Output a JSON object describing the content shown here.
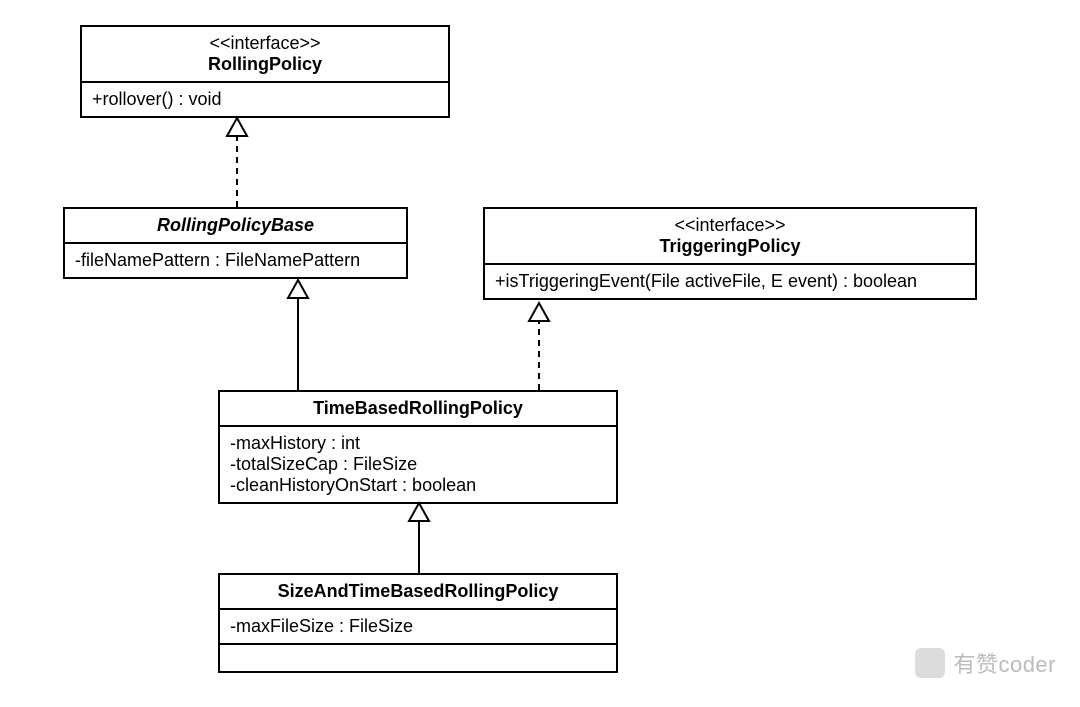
{
  "nodes": {
    "rollingPolicy": {
      "stereotype": "<<interface>>",
      "name": "RollingPolicy",
      "members": [
        "+rollover() : void"
      ]
    },
    "rollingPolicyBase": {
      "name": "RollingPolicyBase",
      "members": [
        "-fileNamePattern : FileNamePattern"
      ]
    },
    "triggeringPolicy": {
      "stereotype": "<<interface>>",
      "name": "TriggeringPolicy",
      "members": [
        "+isTriggeringEvent(File activeFile, E event) : boolean"
      ]
    },
    "timeBasedRollingPolicy": {
      "name": "TimeBasedRollingPolicy",
      "members": [
        "-maxHistory : int",
        "-totalSizeCap : FileSize",
        "-cleanHistoryOnStart : boolean"
      ]
    },
    "sizeAndTimeBasedRollingPolicy": {
      "name": "SizeAndTimeBasedRollingPolicy",
      "members": [
        "-maxFileSize : FileSize"
      ]
    }
  },
  "edges": [
    {
      "from": "rollingPolicyBase",
      "to": "rollingPolicy",
      "kind": "realization"
    },
    {
      "from": "timeBasedRollingPolicy",
      "to": "rollingPolicyBase",
      "kind": "generalization"
    },
    {
      "from": "timeBasedRollingPolicy",
      "to": "triggeringPolicy",
      "kind": "realization"
    },
    {
      "from": "sizeAndTimeBasedRollingPolicy",
      "to": "timeBasedRollingPolicy",
      "kind": "generalization"
    }
  ],
  "watermark": "有赞coder"
}
